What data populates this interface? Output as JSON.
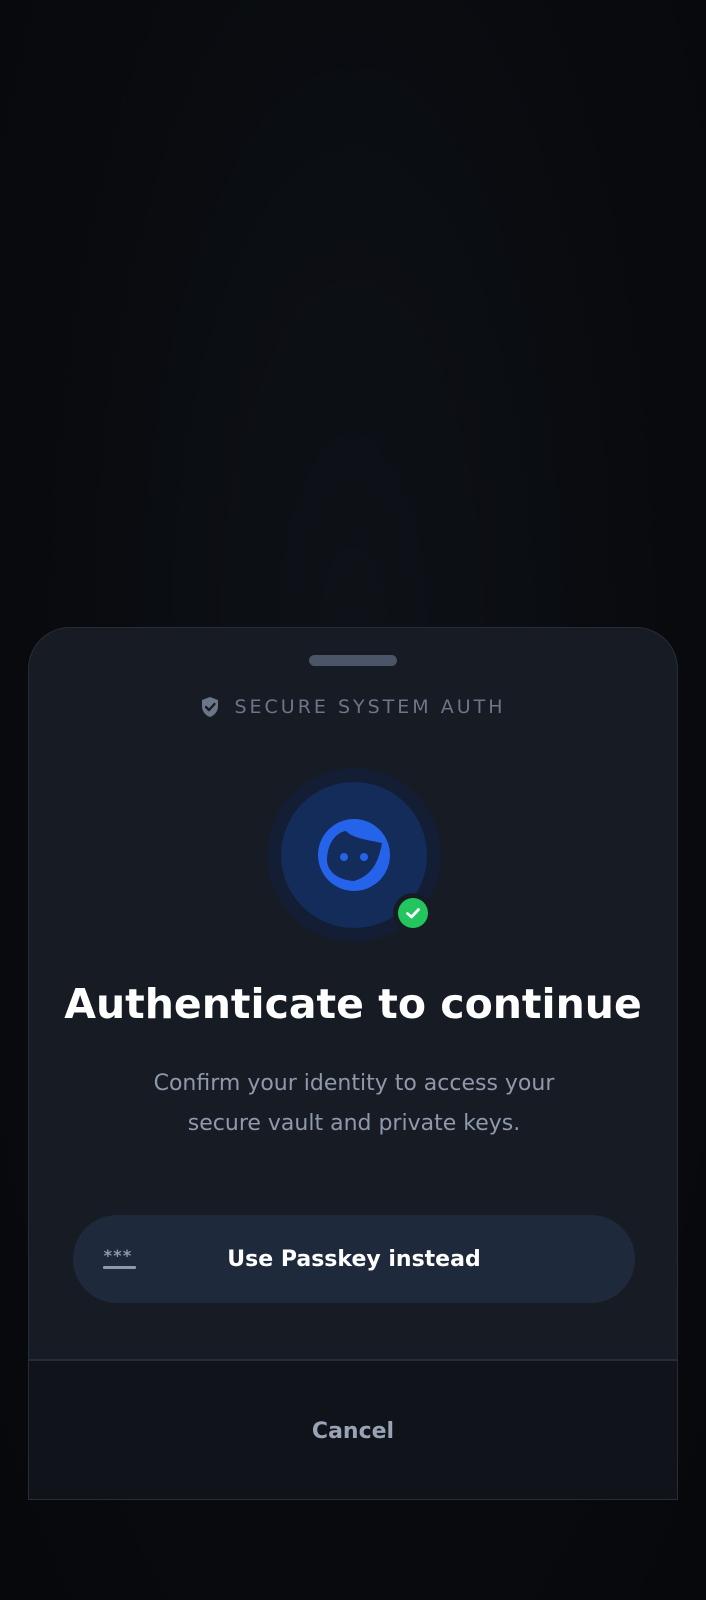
{
  "sheet": {
    "header_title": "SECURE SYSTEM AUTH",
    "header_icon": "shield-check-icon",
    "avatar_icon": "face-icon",
    "badge_icon": "check-circle-icon",
    "heading": "Authenticate to continue",
    "subtitle": "Confirm your identity to access your secure vault and private keys.",
    "passkey_button": {
      "label": "Use Passkey instead",
      "icon": "password-dots-icon",
      "icon_text": "***"
    },
    "cancel_label": "Cancel"
  },
  "colors": {
    "background": "#07090c",
    "sheet": "#171c24",
    "accent": "#2563eb",
    "success": "#22c55e",
    "button": "#1e293b"
  }
}
